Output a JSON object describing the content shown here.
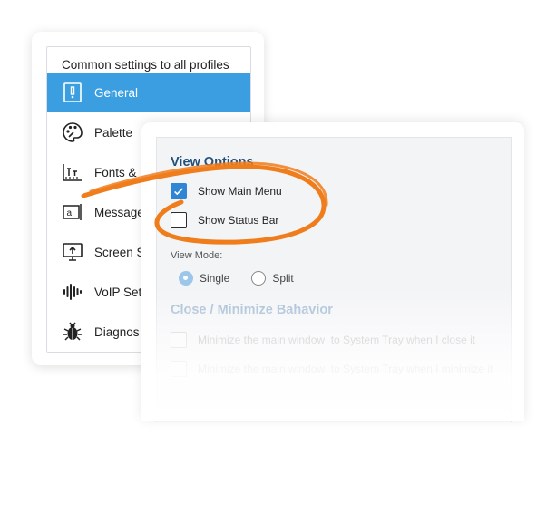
{
  "left_panel": {
    "header": "Common settings to all profiles",
    "items": [
      {
        "label": "General",
        "icon": "general-settings-icon",
        "active": true
      },
      {
        "label": "Palette",
        "icon": "palette-icon",
        "active": false
      },
      {
        "label": "Fonts &",
        "icon": "fonts-icon",
        "active": false
      },
      {
        "label": "Message",
        "icon": "message-icon",
        "active": false
      },
      {
        "label": "Screen S",
        "icon": "screen-icon",
        "active": false
      },
      {
        "label": "VoIP Set",
        "icon": "voip-icon",
        "active": false
      },
      {
        "label": "Diagnos",
        "icon": "bug-icon",
        "active": false
      }
    ]
  },
  "view_options": {
    "title": "View Options",
    "show_main_menu": {
      "label": "Show Main Menu",
      "checked": true
    },
    "show_status_bar": {
      "label": "Show Status Bar",
      "checked": false
    },
    "view_mode_label": "View Mode:",
    "view_mode_options": [
      {
        "label": "Single",
        "selected": true
      },
      {
        "label": "Split",
        "selected": false
      }
    ]
  },
  "close_behavior": {
    "title": "Close / Minimize Bahavior",
    "options": [
      {
        "label": "Minimize the main window  to System Tray when I close it",
        "checked": false
      },
      {
        "label": "Minimize the main window  to System Tray when I minimize it",
        "checked": false
      }
    ]
  },
  "colors": {
    "accent": "#3a9ee0",
    "highlight_ring": "#f07d1c",
    "section_title": "#23507a"
  }
}
